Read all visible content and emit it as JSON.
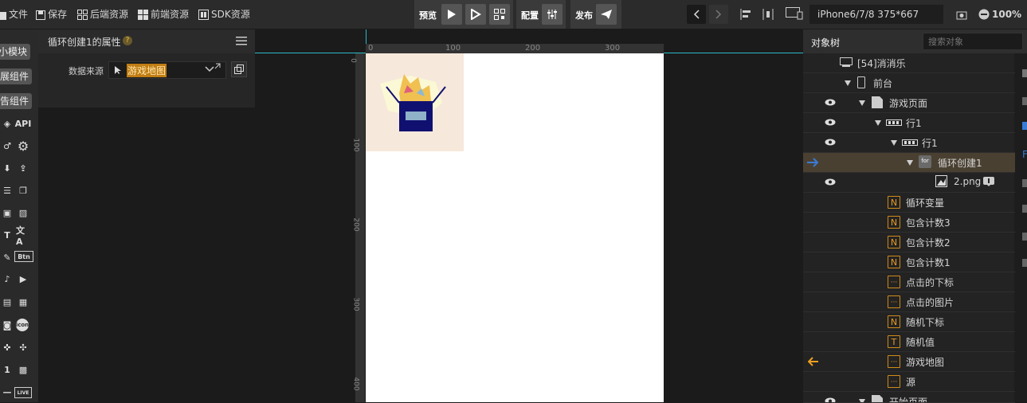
{
  "toolbar": {
    "file": "文件",
    "save": "保存",
    "backend": "后端资源",
    "frontend": "前端资源",
    "sdk": "SDK资源",
    "preview": "预览",
    "config": "配置",
    "publish": "发布",
    "device": "iPhone6/7/8 375*667",
    "zoom": "100%"
  },
  "rail": {
    "btn1": "小模块",
    "btn2": "扩展组件",
    "btn3": "广告组件",
    "api": "API",
    "btn_icon": "Btn",
    "icon_icon": "icon",
    "live_icon": "LIVE"
  },
  "prop": {
    "title": "循环创建1的属性",
    "help": "?",
    "source_label": "数据来源",
    "source_value": "游戏地图"
  },
  "ruler": {
    "top": [
      "0",
      "100",
      "200",
      "300"
    ],
    "left": [
      "0",
      "100",
      "200",
      "300",
      "400"
    ]
  },
  "tree": {
    "tab": "对象树",
    "search_placeholder": "搜索对象",
    "rows": [
      {
        "label": "[54]消消乐"
      },
      {
        "label": "前台"
      },
      {
        "label": "游戏页面"
      },
      {
        "label": "行1"
      },
      {
        "label": "行1"
      },
      {
        "label": "循环创建1",
        "tag": "for"
      },
      {
        "label": "2.png"
      },
      {
        "label": "循环变量",
        "icon": "N"
      },
      {
        "label": "包含计数3",
        "icon": "N"
      },
      {
        "label": "包含计数2",
        "icon": "N"
      },
      {
        "label": "包含计数1",
        "icon": "N"
      },
      {
        "label": "点击的下标",
        "icon": "···"
      },
      {
        "label": "点击的图片",
        "icon": "···"
      },
      {
        "label": "随机下标",
        "icon": "N"
      },
      {
        "label": "随机值",
        "icon": "T"
      },
      {
        "label": "游戏地图",
        "icon": "···"
      },
      {
        "label": "源",
        "icon": "···"
      },
      {
        "label": "开始页面"
      }
    ]
  },
  "colors": {
    "accent": "#f0a020",
    "selected_row": "#4a4032",
    "arrow_blue": "#3a7bd5"
  }
}
